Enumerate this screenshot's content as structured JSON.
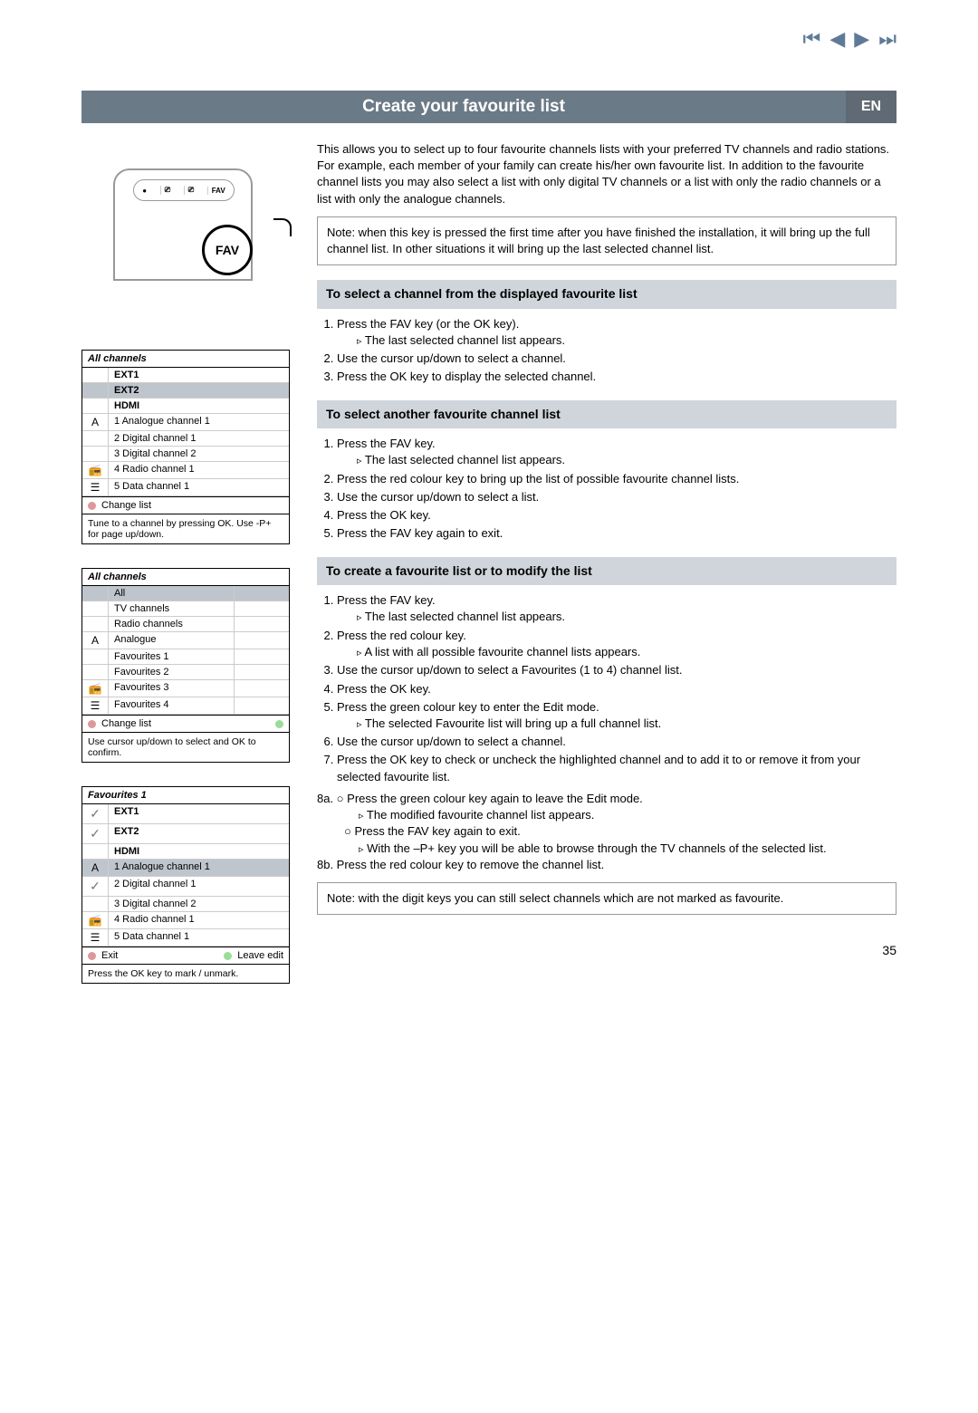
{
  "header": {
    "title": "Create your favourite list",
    "lang": "EN"
  },
  "intro": {
    "p1": "This allows you to select up to four favourite channels lists with your preferred TV channels and radio stations. For example, each member of your family can create his/her own favourite list. In addition to the favourite channel lists you may also select a list with only digital TV channels or a list with only the radio channels or a list with only the analogue channels.",
    "note": "Note: when this key is pressed the first time after you have finished the installation, it will bring up the full channel list. In other situations it will bring up the last selected channel list."
  },
  "remote": {
    "btns": [
      "●",
      "⎚",
      "⎚",
      "FAV"
    ],
    "fav": "FAV"
  },
  "osd1": {
    "title": "All channels",
    "headers": [
      "EXT1",
      "EXT2",
      "HDMI"
    ],
    "rows": [
      {
        "icon": "A",
        "text": "1 Analogue channel 1"
      },
      {
        "icon": "",
        "text": "2 Digital channel 1"
      },
      {
        "icon": "",
        "text": "3 Digital channel 2"
      },
      {
        "icon": "📻",
        "text": "4 Radio channel 1"
      },
      {
        "icon": "☰",
        "text": "5 Data channel 1"
      }
    ],
    "action": "Change list",
    "footer": "Tune to a channel by pressing OK. Use -P+ for page up/down."
  },
  "osd2": {
    "title": "All channels",
    "rows": [
      "All",
      "TV channels",
      "Radio channels",
      "Analogue",
      "Favourites 1",
      "Favourites 2",
      "Favourites 3",
      "Favourites 4"
    ],
    "action": "Change list",
    "footer": "Use cursor up/down to select and OK to confirm."
  },
  "osd3": {
    "title": "Favourites 1",
    "headers": [
      "EXT1",
      "EXT2",
      "HDMI"
    ],
    "rows": [
      {
        "icon": "A",
        "text": "1 Analogue channel 1",
        "chk": true
      },
      {
        "icon": "✓",
        "text": "2 Digital channel 1"
      },
      {
        "icon": "",
        "text": "3 Digital channel 2"
      },
      {
        "icon": "📻",
        "text": "4 Radio channel 1"
      },
      {
        "icon": "☰",
        "text": "5 Data channel 1"
      }
    ],
    "action1": "Exit",
    "action2": "Leave edit",
    "footer": "Press the OK key to mark / unmark."
  },
  "sec1": {
    "heading": "To select a channel from the displayed favourite list",
    "l1": "Press the FAV key (or the OK key).",
    "l1a": "The last selected channel list appears.",
    "l2": "Use the cursor up/down to select a channel.",
    "l3": "Press the OK key to display the selected channel."
  },
  "sec2": {
    "heading": "To select another favourite channel list",
    "l1": "Press the FAV key.",
    "l1a": "The last selected channel list appears.",
    "l2": "Press the red colour key to bring up the list of possible favourite channel lists.",
    "l3": "Use the cursor up/down to select a list.",
    "l4": "Press the OK key.",
    "l5": "Press the FAV key again to exit."
  },
  "sec3": {
    "heading": "To create a favourite list or to modify the list",
    "l1": "Press the FAV key.",
    "l1a": "The last selected channel list appears.",
    "l2": "Press the red colour key.",
    "l2a": "A list with all possible favourite channel lists appears.",
    "l3": "Use the cursor up/down to select a Favourites (1 to 4) channel list.",
    "l4": "Press the OK key.",
    "l5": "Press the green colour key to enter the Edit mode.",
    "l5a": "The selected Favourite list will bring up a full channel list.",
    "l6": "Use the cursor up/down to select a channel.",
    "l7": "Press the OK key to check or uncheck the highlighted channel and to add it to or remove it from your selected favourite list.",
    "l8a": "8a. ○ Press the green colour key again to leave the Edit mode.",
    "l8a1": "The modified favourite channel list appears.",
    "l8a2": "○ Press the FAV key again to exit.",
    "l8a3": "With the –P+ key you will be able to browse through the TV channels of the selected list.",
    "l8b": "8b. Press the red colour key to remove the channel list.",
    "note": "Note: with the digit keys you can still select channels which are not marked as favourite."
  },
  "pagenum": "35"
}
